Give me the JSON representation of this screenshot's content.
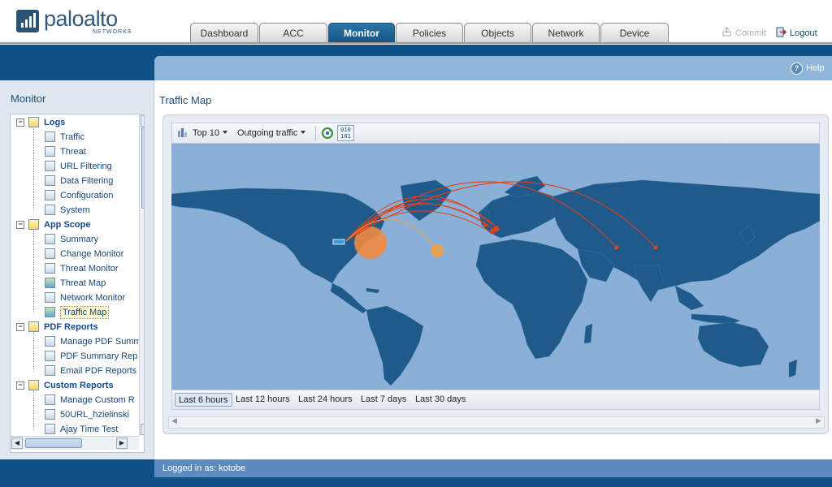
{
  "header": {
    "brand": "paloalto",
    "brand_sub": "NETWORKS",
    "tabs": [
      "Dashboard",
      "ACC",
      "Monitor",
      "Policies",
      "Objects",
      "Network",
      "Device"
    ],
    "active_tab": "Monitor",
    "commit_label": "Commit",
    "logout_label": "Logout"
  },
  "band": {
    "help_label": "Help"
  },
  "sidebar": {
    "title": "Monitor",
    "tree": [
      {
        "label": "Logs",
        "group": true
      },
      {
        "label": "Traffic"
      },
      {
        "label": "Threat"
      },
      {
        "label": "URL Filtering"
      },
      {
        "label": "Data Filtering"
      },
      {
        "label": "Configuration"
      },
      {
        "label": "System"
      },
      {
        "label": "App Scope",
        "group": true
      },
      {
        "label": "Summary"
      },
      {
        "label": "Change Monitor"
      },
      {
        "label": "Threat Monitor"
      },
      {
        "label": "Threat Map"
      },
      {
        "label": "Network Monitor"
      },
      {
        "label": "Traffic Map",
        "selected": true
      },
      {
        "label": "PDF Reports",
        "group": true
      },
      {
        "label": "Manage PDF Summ"
      },
      {
        "label": "PDF Summary Rep"
      },
      {
        "label": "Email PDF Reports"
      },
      {
        "label": "Custom Reports",
        "group": true
      },
      {
        "label": "Manage Custom R"
      },
      {
        "label": "50URL_hzielinski"
      },
      {
        "label": "Ajay Time Test"
      }
    ]
  },
  "main": {
    "title": "Traffic Map",
    "toolbar": {
      "top_label": "Top 10",
      "direction_label": "Outgoing traffic",
      "binary_top": "010",
      "binary_bottom": "101"
    },
    "time_ranges": [
      "Last 6 hours",
      "Last 12 hours",
      "Last 24 hours",
      "Last 7 days",
      "Last 30 days"
    ],
    "active_time_range": "Last 6 hours"
  },
  "footer": {
    "logged_in": "Logged in as: kotobe"
  },
  "colors": {
    "brand_blue": "#0f5187",
    "ocean": "#8ab0d8",
    "land": "#1f5a8a",
    "arc": "#e0401a",
    "bubble": "#f08a40"
  }
}
